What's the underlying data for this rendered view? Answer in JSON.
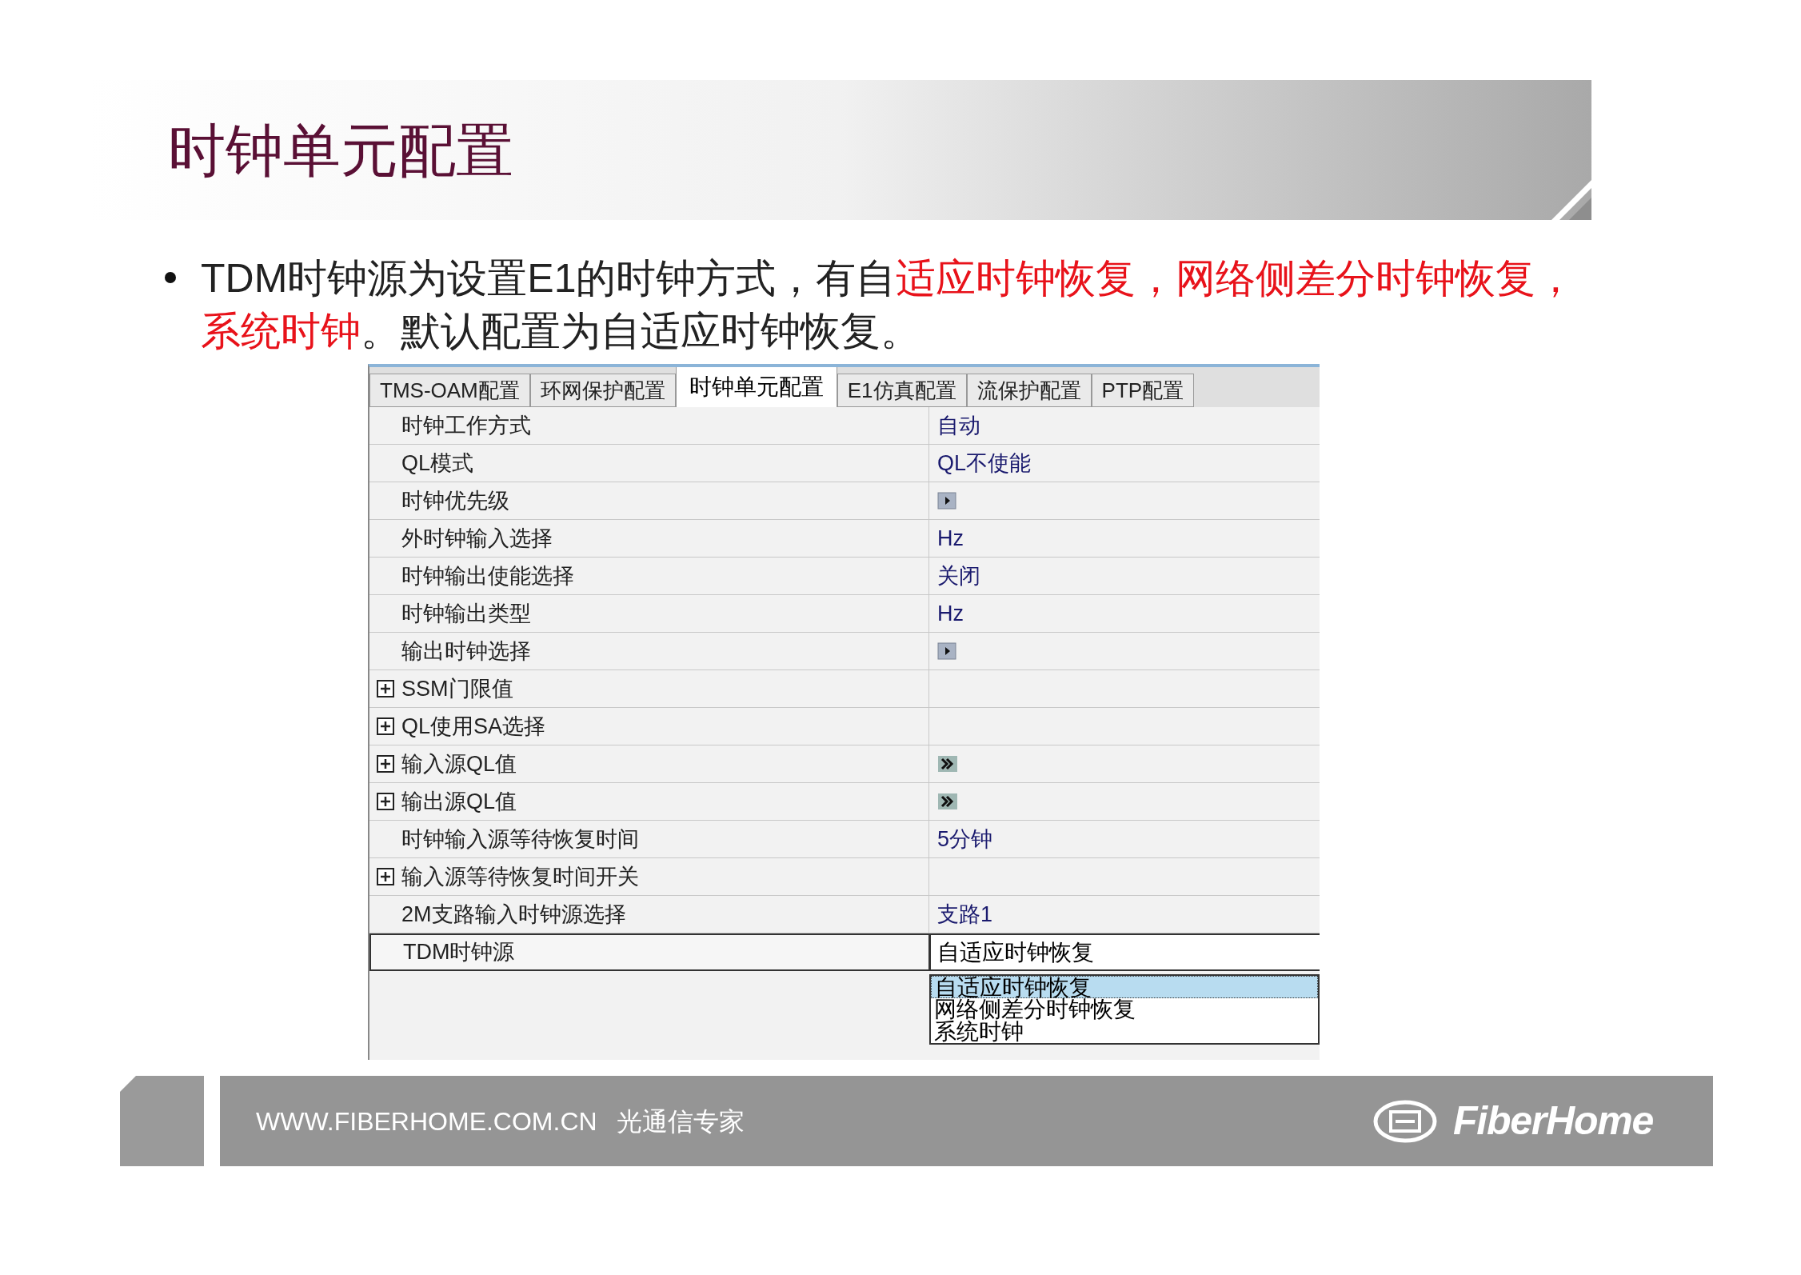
{
  "slide_title": "时钟单元配置",
  "bullet": [
    {
      "text": "TDM时钟源为设置E1的时钟方式，有自",
      "highlight": false
    },
    {
      "text": "适应时钟恢复，网络侧差分时钟恢复，系统时钟",
      "highlight": true
    },
    {
      "text": "。默认配置为自适应时钟恢复。",
      "highlight": false
    }
  ],
  "tabs": [
    {
      "label": "TMS-OAM配置",
      "selected": false
    },
    {
      "label": "环网保护配置",
      "selected": false
    },
    {
      "label": "时钟单元配置",
      "selected": true
    },
    {
      "label": "E1仿真配置",
      "selected": false
    },
    {
      "label": "流保护配置",
      "selected": false
    },
    {
      "label": "PTP配置",
      "selected": false
    }
  ],
  "rows": [
    {
      "label": "时钟工作方式",
      "expandable": false,
      "selected": false,
      "value": {
        "kind": "text",
        "text": "自动"
      }
    },
    {
      "label": "QL模式",
      "expandable": false,
      "selected": false,
      "value": {
        "kind": "text",
        "text": "QL不使能"
      }
    },
    {
      "label": "时钟优先级",
      "expandable": false,
      "selected": false,
      "value": {
        "kind": "play"
      }
    },
    {
      "label": "外时钟输入选择",
      "expandable": false,
      "selected": false,
      "value": {
        "kind": "text",
        "text": "Hz"
      }
    },
    {
      "label": "时钟输出使能选择",
      "expandable": false,
      "selected": false,
      "value": {
        "kind": "text",
        "text": "关闭"
      }
    },
    {
      "label": "时钟输出类型",
      "expandable": false,
      "selected": false,
      "value": {
        "kind": "text",
        "text": "Hz"
      }
    },
    {
      "label": "输出时钟选择",
      "expandable": false,
      "selected": false,
      "value": {
        "kind": "play"
      }
    },
    {
      "label": "SSM门限值",
      "expandable": true,
      "selected": false,
      "value": {
        "kind": "none"
      }
    },
    {
      "label": "QL使用SA选择",
      "expandable": true,
      "selected": false,
      "value": {
        "kind": "none"
      }
    },
    {
      "label": "输入源QL值",
      "expandable": true,
      "selected": false,
      "value": {
        "kind": "forward"
      }
    },
    {
      "label": "输出源QL值",
      "expandable": true,
      "selected": false,
      "value": {
        "kind": "forward"
      }
    },
    {
      "label": "时钟输入源等待恢复时间",
      "expandable": false,
      "selected": false,
      "value": {
        "kind": "text",
        "text": "5分钟"
      }
    },
    {
      "label": "输入源等待恢复时间开关",
      "expandable": true,
      "selected": false,
      "value": {
        "kind": "none"
      }
    },
    {
      "label": "2M支路输入时钟源选择",
      "expandable": false,
      "selected": false,
      "value": {
        "kind": "text",
        "text": "支路1"
      }
    },
    {
      "label": "TDM时钟源",
      "expandable": false,
      "selected": true,
      "value": {
        "kind": "dropdown",
        "text": "自适应时钟恢复"
      }
    }
  ],
  "dropdown_options": [
    {
      "label": "自适应时钟恢复",
      "selected": true
    },
    {
      "label": "网络侧差分时钟恢复",
      "selected": false
    },
    {
      "label": "系统时钟",
      "selected": false
    }
  ],
  "footer": {
    "url": "WWW.FIBERHOME.COM.CN",
    "slogan": "光通信专家",
    "logo_text": "FiberHome"
  }
}
